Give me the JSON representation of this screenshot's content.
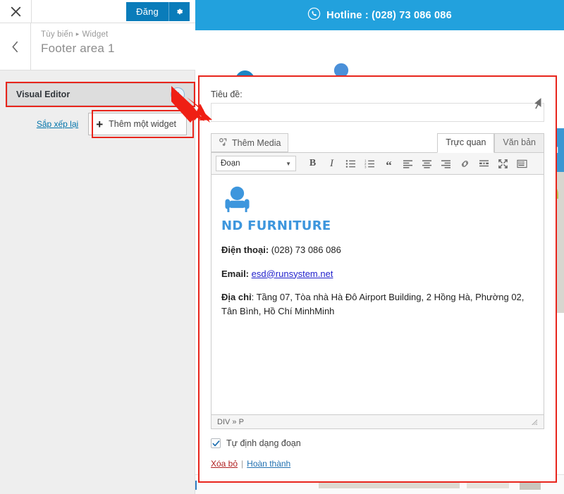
{
  "customizer": {
    "close_icon": "close-x-icon",
    "publish_label": "Đăng",
    "gear_icon": "gear-icon",
    "back_icon": "chevron-left-icon",
    "breadcrumb": {
      "root": "Tùy biến",
      "separator": "▸",
      "current": "Widget"
    },
    "panel_title": "Footer area 1",
    "widget_row": {
      "label": "Visual Editor",
      "collapse_icon": "collapse-left-icon"
    },
    "reorder_link": "Sắp xếp lại",
    "add_widget": {
      "plus": "+",
      "label": "Thêm một widget"
    }
  },
  "preview": {
    "hotline": {
      "icon": "phone-icon",
      "text": "Hotline : (028) 73 086 086",
      "bar_color": "#22a1dd"
    },
    "edit_pencil_icon": "pencil-edit-icon",
    "brand": {
      "logo_icon": "armchair-icon",
      "name": "ND FURNITURE",
      "color": "#2f5fa8"
    },
    "side_tab_label": "M"
  },
  "widget_panel": {
    "title_field": {
      "label": "Tiêu đề:",
      "value": "",
      "placeholder": ""
    },
    "add_media": {
      "icon": "media-icon",
      "label": "Thêm Media"
    },
    "tabs": [
      {
        "label": "Trực quan",
        "active": true
      },
      {
        "label": "Văn bản",
        "active": false
      }
    ],
    "toolbar": {
      "format_select": {
        "value": "Đoạn",
        "caret": "▼"
      },
      "buttons": [
        {
          "name": "bold-icon",
          "glyph": "B"
        },
        {
          "name": "italic-icon",
          "glyph": "I"
        },
        {
          "name": "bulleted-list-icon",
          "glyph": ""
        },
        {
          "name": "numbered-list-icon",
          "glyph": ""
        },
        {
          "name": "blockquote-icon",
          "glyph": "“"
        },
        {
          "name": "align-left-icon",
          "glyph": ""
        },
        {
          "name": "align-center-icon",
          "glyph": ""
        },
        {
          "name": "align-right-icon",
          "glyph": ""
        },
        {
          "name": "insert-link-icon",
          "glyph": ""
        },
        {
          "name": "read-more-icon",
          "glyph": ""
        },
        {
          "name": "fullscreen-icon",
          "glyph": ""
        },
        {
          "name": "toolbar-toggle-icon",
          "glyph": ""
        }
      ]
    },
    "content": {
      "logo_icon": "armchair-icon",
      "logo_name": "ND FURNITURE",
      "phone_label": "Điện thoại:",
      "phone_value": "(028) 73 086 086",
      "email_label": "Email:",
      "email_value": "esd@runsystem.net",
      "address_label": "Địa chỉ",
      "address_value": ": Tầng 07, Tòa nhà Hà Đô Airport Building, 2 Hồng Hà, Phường 02, Tân Bình, Hồ Chí MinhMinh"
    },
    "status_path": "DIV » P",
    "auto_paragraph": {
      "label": "Tự định dạng đoạn",
      "checked": true,
      "check_glyph": "✔"
    },
    "links": {
      "delete": "Xóa bỏ",
      "separator": "|",
      "done": "Hoàn thành"
    }
  },
  "annotations": {
    "highlight_color": "#e8251c",
    "arrow": "red-arrow-pointer",
    "cursor": "mouse-cursor-arrow"
  }
}
